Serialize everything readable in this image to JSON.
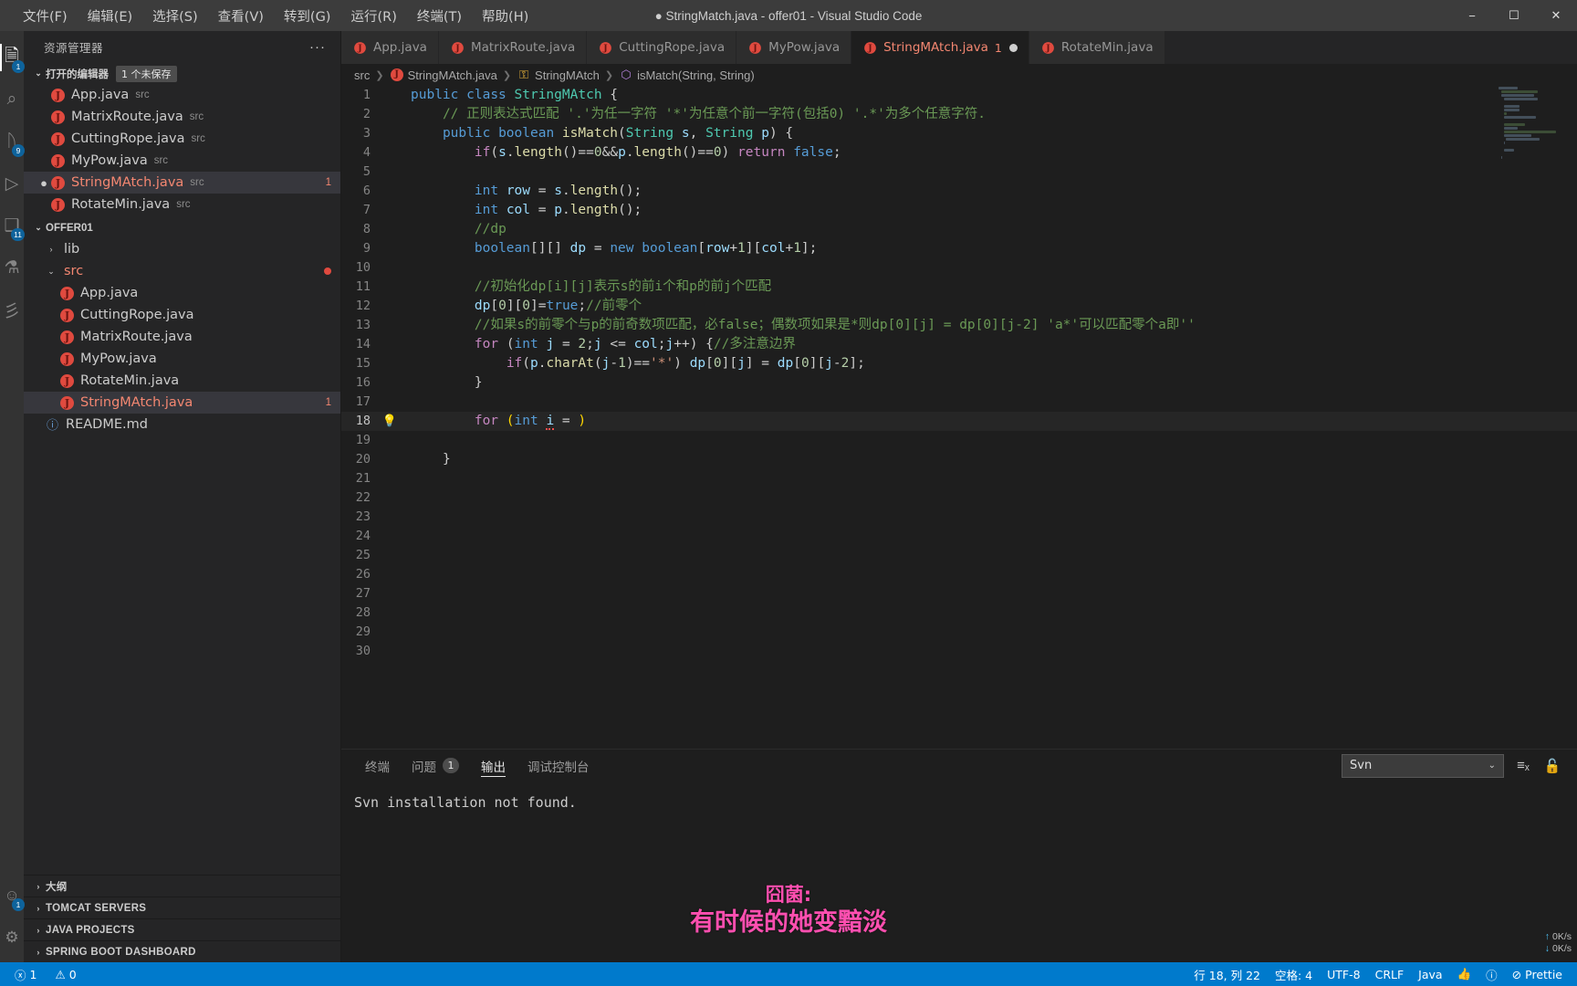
{
  "window": {
    "title": "● StringMatch.java - offer01 - Visual Studio Code",
    "minimize": "−",
    "maximize": "☐",
    "close": "✕"
  },
  "menu": [
    {
      "label": "文件(F)",
      "name": "menu-file"
    },
    {
      "label": "编辑(E)",
      "name": "menu-edit"
    },
    {
      "label": "选择(S)",
      "name": "menu-selection"
    },
    {
      "label": "查看(V)",
      "name": "menu-view"
    },
    {
      "label": "转到(G)",
      "name": "menu-go"
    },
    {
      "label": "运行(R)",
      "name": "menu-run"
    },
    {
      "label": "终端(T)",
      "name": "menu-terminal"
    },
    {
      "label": "帮助(H)",
      "name": "menu-help"
    }
  ],
  "activitybar": {
    "items": [
      {
        "icon": "files-explorer-icon",
        "glyph": "🗎",
        "badge": "1",
        "active": true
      },
      {
        "icon": "search-icon",
        "glyph": "⌕",
        "badge": "",
        "active": false
      },
      {
        "icon": "source-control-icon",
        "glyph": "ᚢ",
        "badge": "9",
        "active": false
      },
      {
        "icon": "run-debug-icon",
        "glyph": "▷",
        "badge": "",
        "active": false
      },
      {
        "icon": "extensions-icon",
        "glyph": "❑",
        "badge": "11",
        "active": false
      },
      {
        "icon": "testing-beaker-icon",
        "glyph": "⚗",
        "badge": "",
        "active": false
      },
      {
        "icon": "maven-icon",
        "glyph": "彡",
        "badge": "",
        "active": false
      }
    ],
    "bottom": [
      {
        "icon": "accounts-icon",
        "glyph": "☺",
        "badge": "1"
      },
      {
        "icon": "settings-gear-icon",
        "glyph": "⚙",
        "badge": ""
      }
    ]
  },
  "sidebar": {
    "header_title": "资源管理器",
    "more_actions": "···",
    "open_editors": {
      "label": "打开的编辑器",
      "badge": "1 个未保存",
      "chevron": "⌄",
      "items": [
        {
          "name": "App.java",
          "sub": "src",
          "dirty": false,
          "state": "normal",
          "count": ""
        },
        {
          "name": "MatrixRoute.java",
          "sub": "src",
          "dirty": false,
          "state": "normal",
          "count": ""
        },
        {
          "name": "CuttingRope.java",
          "sub": "src",
          "dirty": false,
          "state": "normal",
          "count": ""
        },
        {
          "name": "MyPow.java",
          "sub": "src",
          "dirty": false,
          "state": "normal",
          "count": ""
        },
        {
          "name": "StringMAtch.java",
          "sub": "src",
          "dirty": true,
          "state": "err",
          "count": "1"
        },
        {
          "name": "RotateMin.java",
          "sub": "src",
          "dirty": false,
          "state": "normal",
          "count": ""
        }
      ]
    },
    "project": {
      "label": "OFFER01",
      "chevron": "⌄",
      "folders": [
        {
          "label": "lib",
          "chevron": "›",
          "expanded": false,
          "dot": false
        },
        {
          "label": "src",
          "chevron": "⌄",
          "expanded": true,
          "dot": true
        }
      ],
      "files": [
        {
          "name": "App.java",
          "state": "normal",
          "count": ""
        },
        {
          "name": "CuttingRope.java",
          "state": "normal",
          "count": ""
        },
        {
          "name": "MatrixRoute.java",
          "state": "normal",
          "count": ""
        },
        {
          "name": "MyPow.java",
          "state": "normal",
          "count": ""
        },
        {
          "name": "RotateMin.java",
          "state": "normal",
          "count": ""
        },
        {
          "name": "StringMAtch.java",
          "state": "err",
          "count": "1"
        }
      ],
      "readme": {
        "name": "README.md"
      }
    },
    "sections": [
      {
        "label": "大纲",
        "chevron": "›",
        "name": "sidebar-section-outline"
      },
      {
        "label": "TOMCAT SERVERS",
        "chevron": "›",
        "name": "sidebar-section-tomcat-servers"
      },
      {
        "label": "JAVA PROJECTS",
        "chevron": "›",
        "name": "sidebar-section-java-projects"
      },
      {
        "label": "SPRING BOOT DASHBOARD",
        "chevron": "›",
        "name": "sidebar-section-spring-boot-dashboard"
      }
    ]
  },
  "tabs": [
    {
      "label": "App.java",
      "active": false,
      "dirty": false,
      "count": "",
      "err": false
    },
    {
      "label": "MatrixRoute.java",
      "active": false,
      "dirty": false,
      "count": "",
      "err": false
    },
    {
      "label": "CuttingRope.java",
      "active": false,
      "dirty": false,
      "count": "",
      "err": false
    },
    {
      "label": "MyPow.java",
      "active": false,
      "dirty": false,
      "count": "",
      "err": false
    },
    {
      "label": "StringMAtch.java",
      "active": true,
      "dirty": true,
      "count": "1",
      "err": true
    },
    {
      "label": "RotateMin.java",
      "active": false,
      "dirty": false,
      "count": "",
      "err": false
    }
  ],
  "breadcrumb": [
    {
      "label": "src",
      "icon": "folder"
    },
    {
      "label": "StringMAtch.java",
      "icon": "java"
    },
    {
      "label": "StringMAtch",
      "icon": "class"
    },
    {
      "label": "isMatch(String, String)",
      "icon": "method"
    }
  ],
  "editor": {
    "total_lines": 30,
    "bulb_line": 18,
    "bulb_glyph": "💡",
    "code_lines": [
      {
        "n": 1,
        "text": "public class StringMAtch {"
      },
      {
        "n": 2,
        "text": "    // 正则表达式匹配 '.'为任一字符 '*'为任意个前一字符(包括0) '.*'为多个任意字符."
      },
      {
        "n": 3,
        "text": "    public boolean isMatch(String s, String p) {"
      },
      {
        "n": 4,
        "text": "        if(s.length()==0&&p.length()==0) return false;"
      },
      {
        "n": 5,
        "text": ""
      },
      {
        "n": 6,
        "text": "        int row = s.length();"
      },
      {
        "n": 7,
        "text": "        int col = p.length();"
      },
      {
        "n": 8,
        "text": "        //dp"
      },
      {
        "n": 9,
        "text": "        boolean[][] dp = new boolean[row+1][col+1];"
      },
      {
        "n": 10,
        "text": ""
      },
      {
        "n": 11,
        "text": "        //初始化dp[i][j]表示s的前i个和p的前j个匹配"
      },
      {
        "n": 12,
        "text": "        dp[0][0]=true;//前零个"
      },
      {
        "n": 13,
        "text": "        //如果s的前零个与p的前奇数项匹配，必false；偶数项如果是*则dp[0][j] = dp[0][j-2] 'a*'可以匹配零个a即''"
      },
      {
        "n": 14,
        "text": "        for (int j = 2;j <= col;j++) {//多注意边界"
      },
      {
        "n": 15,
        "text": "            if(p.charAt(j-1)=='*') dp[0][j] = dp[0][j-2];"
      },
      {
        "n": 16,
        "text": "        }"
      },
      {
        "n": 17,
        "text": ""
      },
      {
        "n": 18,
        "text": "        for (int i = )"
      },
      {
        "n": 19,
        "text": ""
      },
      {
        "n": 20,
        "text": "    }"
      },
      {
        "n": 21,
        "text": ""
      },
      {
        "n": 22,
        "text": ""
      },
      {
        "n": 23,
        "text": ""
      },
      {
        "n": 24,
        "text": ""
      },
      {
        "n": 25,
        "text": ""
      },
      {
        "n": 26,
        "text": ""
      },
      {
        "n": 27,
        "text": ""
      },
      {
        "n": 28,
        "text": ""
      },
      {
        "n": 29,
        "text": ""
      },
      {
        "n": 30,
        "text": ""
      }
    ]
  },
  "panel": {
    "tabs": [
      {
        "label": "终端",
        "badge": "",
        "active": false
      },
      {
        "label": "问题",
        "badge": "1",
        "active": false
      },
      {
        "label": "输出",
        "badge": "",
        "active": true
      },
      {
        "label": "调试控制台",
        "badge": "",
        "active": false
      }
    ],
    "select_value": "Svn",
    "select_chevron": "⌄",
    "clear_icon": "≡ₓ",
    "lock_icon": "🔓",
    "output_text": "Svn installation not found."
  },
  "watermark": {
    "line1": "囧菌:",
    "line2": "有时候的她变黯淡"
  },
  "netspeed": {
    "up": "0K/s",
    "down": "0K/s",
    "up_arrow": "↑",
    "down_arrow": "↓"
  },
  "statusbar": {
    "left": [
      {
        "label": "1",
        "icon": "error-icon",
        "glyph": "ⓧ",
        "name": "status-errors"
      },
      {
        "label": "0",
        "icon": "warning-icon",
        "glyph": "⚠",
        "name": "status-warnings"
      }
    ],
    "right": [
      {
        "label": "行 18, 列 22",
        "glyph": "",
        "name": "status-line-col"
      },
      {
        "label": "空格: 4",
        "glyph": "",
        "name": "status-indentation"
      },
      {
        "label": "UTF-8",
        "glyph": "",
        "name": "status-encoding"
      },
      {
        "label": "CRLF",
        "glyph": "",
        "name": "status-eol"
      },
      {
        "label": "Java",
        "glyph": "",
        "name": "status-language"
      },
      {
        "label": "",
        "glyph": "👍",
        "name": "status-feedback"
      },
      {
        "label": "",
        "glyph": "ⓘ",
        "name": "status-notifications"
      },
      {
        "label": "Prettie",
        "glyph": "⊘",
        "name": "status-prettier"
      }
    ]
  },
  "colors": {
    "accent": "#007acc",
    "error": "#f48771",
    "java_icon": "#e04a3f",
    "watermark": "#ff4fb0"
  }
}
